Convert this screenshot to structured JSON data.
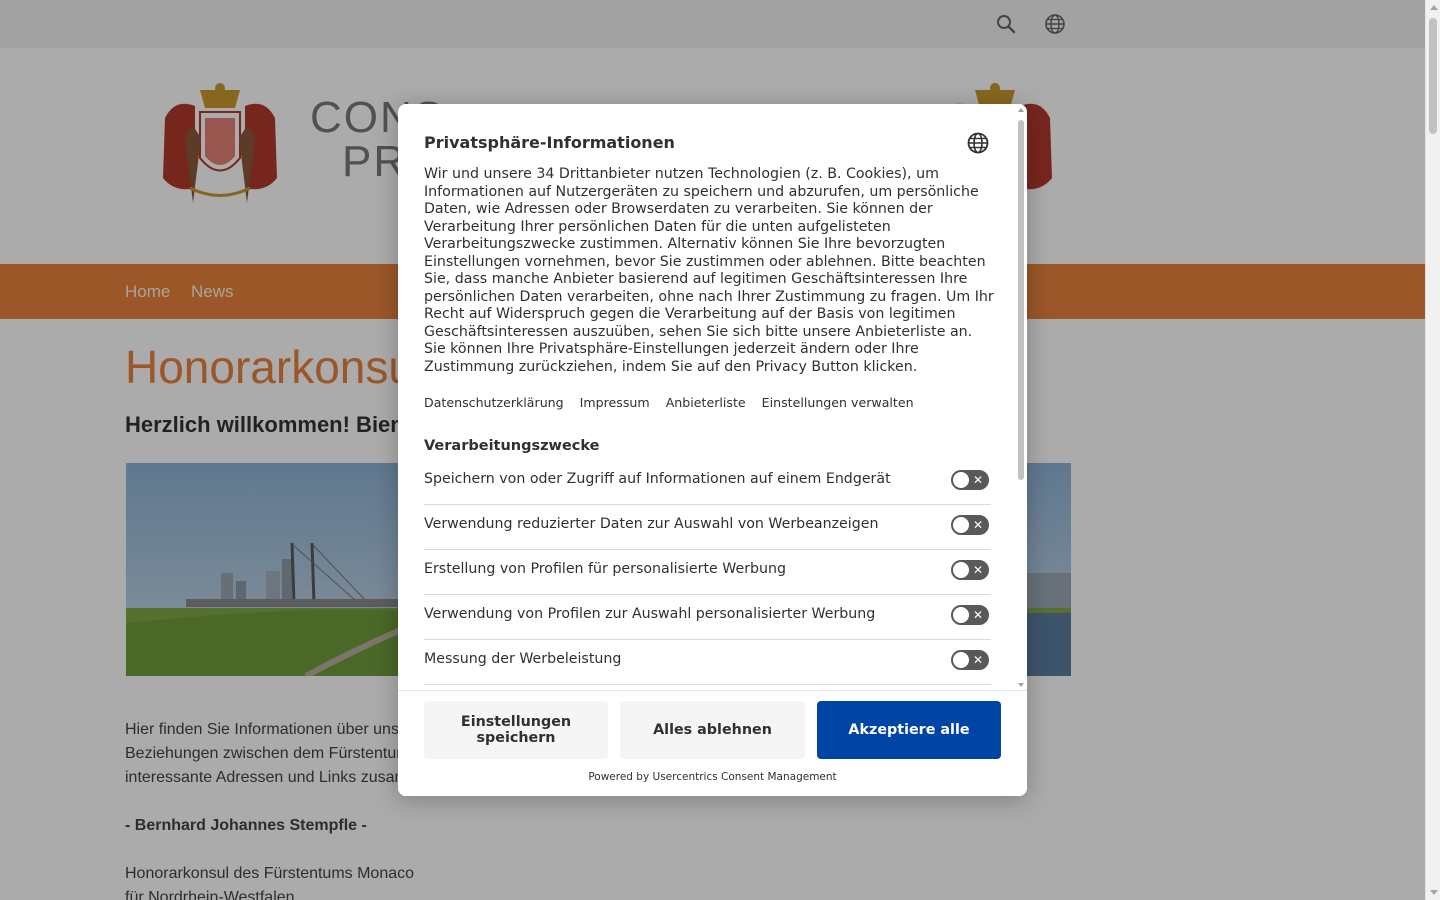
{
  "site": {
    "brand_line1": "CONS",
    "brand_line2": "PR",
    "nav": [
      "Home",
      "News"
    ],
    "page_title": "Honorarkonsu",
    "welcome": "Herzlich willkommen! Bien",
    "body_line1": "Hier finden Sie Informationen über unser",
    "body_line2": "Beziehungen zwischen dem Fürstentum M",
    "body_line3": "interessante Adressen und Links zusamm",
    "signature": "- Bernhard Johannes Stempfle -",
    "role_line1": "Honorarkonsul des Fürstentums Monaco",
    "role_line2": "für Nordrhein-Westfalen",
    "accent_color": "#e8823c"
  },
  "consent": {
    "title": "Privatsphäre-Informationen",
    "description": "Wir und unsere 34 Drittanbieter nutzen Technologien (z. B. Cookies), um Informationen auf Nutzergeräten zu speichern und abzurufen, um persönliche Daten, wie Adressen oder Browserdaten zu verarbeiten. Sie können der Verarbeitung Ihrer persönlichen Daten für die unten aufgelisteten Verarbeitungszwecke zustimmen. Alternativ können Sie Ihre bevorzugten Einstellungen vornehmen, bevor Sie zustimmen oder ablehnen. Bitte beachten Sie, dass manche Anbieter basierend auf legitimen Geschäftsinteressen Ihre persönlichen Daten verarbeiten, ohne nach Ihrer Zustimmung zu fragen. Um Ihr Recht auf Widerspruch gegen die Verarbeitung auf der Basis von legitimen Geschäftsinteressen auszuüben, sehen Sie sich bitte unsere Anbieterliste an. Sie können Ihre Privatsphäre-Einstellungen jederzeit ändern oder Ihre Zustimmung zurückziehen, indem Sie auf den Privacy Button klicken.",
    "links": {
      "privacy": "Datenschutzerklärung",
      "imprint": "Impressum",
      "vendors": "Anbieterliste",
      "settings": "Einstellungen verwalten"
    },
    "purposes_title": "Verarbeitungszwecke",
    "purposes": [
      {
        "label": "Speichern von oder Zugriff auf Informationen auf einem Endgerät",
        "enabled": false
      },
      {
        "label": "Verwendung reduzierter Daten zur Auswahl von Werbeanzeigen",
        "enabled": false
      },
      {
        "label": "Erstellung von Profilen für personalisierte Werbung",
        "enabled": false
      },
      {
        "label": "Verwendung von Profilen zur Auswahl personalisierter Werbung",
        "enabled": false
      },
      {
        "label": "Messung der Werbeleistung",
        "enabled": false
      }
    ],
    "buttons": {
      "save": "Einstellungen speichern",
      "deny": "Alles ablehnen",
      "accept": "Akzeptiere alle"
    },
    "powered_by": "Powered by Usercentrics Consent Management",
    "primary_color": "#0045a5"
  }
}
